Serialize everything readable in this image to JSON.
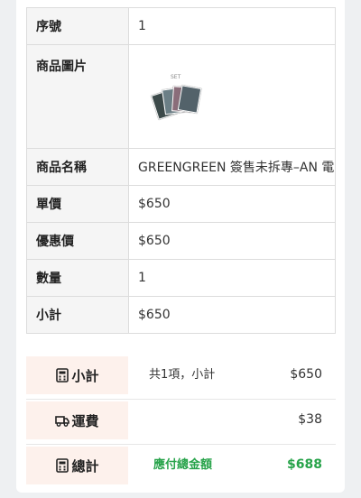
{
  "detail": {
    "rows": [
      {
        "label": "序號",
        "value": "1"
      },
      {
        "label": "商品圖片"
      },
      {
        "label": "商品名稱",
        "value": "GREENGREEN 簽售未拆專–AN 電"
      },
      {
        "label": "單價",
        "value": "$650"
      },
      {
        "label": "優惠價",
        "value": "$650"
      },
      {
        "label": "數量",
        "value": "1"
      },
      {
        "label": "小計",
        "value": "$650"
      }
    ],
    "image_caption": "SET"
  },
  "summary": {
    "subtotal": {
      "label": "小計",
      "mid": "共1項，小計",
      "value": "$650",
      "icon": "calculator-icon"
    },
    "shipping": {
      "label": "運費",
      "value": "$38",
      "icon": "truck-icon"
    },
    "total": {
      "label": "總計",
      "mid": "應付總金額",
      "value": "$688",
      "icon": "calculator-icon"
    },
    "accent_color": "#27a34a",
    "label_bg": "#fdf1ec"
  }
}
